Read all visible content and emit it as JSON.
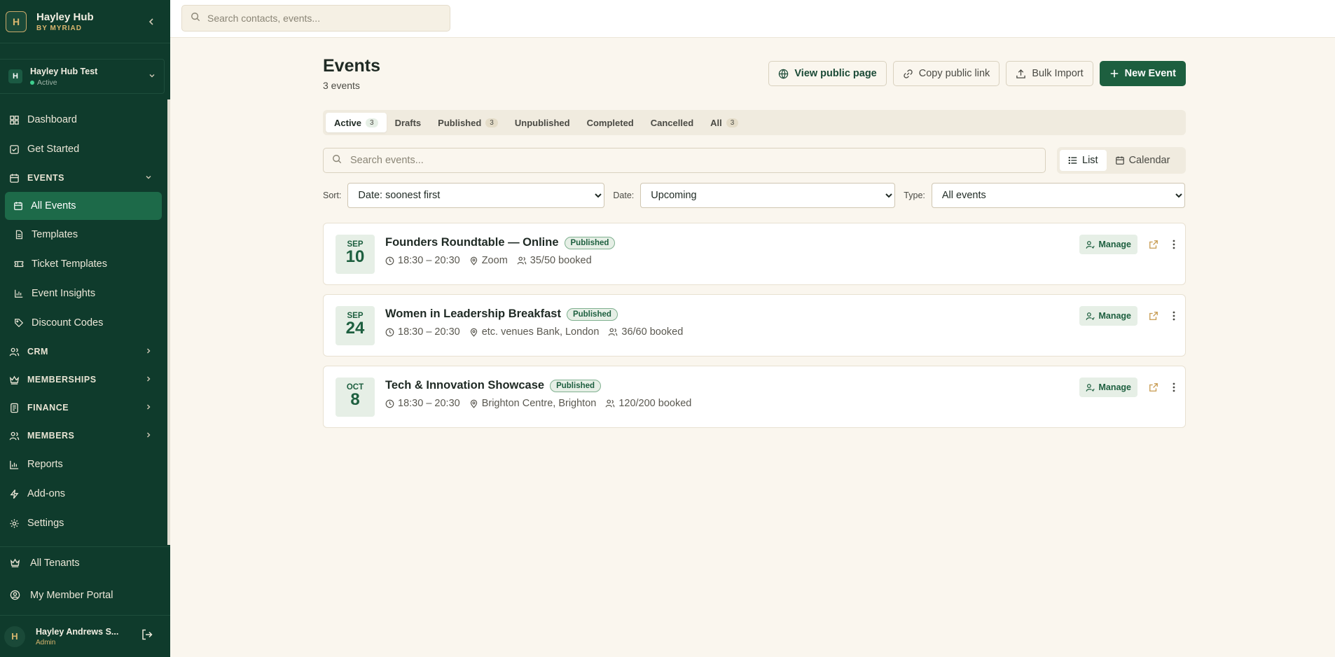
{
  "brand": {
    "logo": "H",
    "name": "Hayley Hub",
    "sub": "BY MYRIAD"
  },
  "tenant": {
    "initial": "H",
    "name": "Hayley Hub Test",
    "status": "Active"
  },
  "nav": {
    "dashboard": "Dashboard",
    "get_started": "Get Started",
    "events_section": "EVENTS",
    "events_items": [
      "All Events",
      "Templates",
      "Ticket Templates",
      "Event Insights",
      "Discount Codes"
    ],
    "crm": "CRM",
    "memberships": "MEMBERSHIPS",
    "finance": "FINANCE",
    "members": "MEMBERS",
    "reports": "Reports",
    "addons": "Add-ons",
    "settings": "Settings"
  },
  "bottom": {
    "all_tenants": "All Tenants",
    "member_portal": "My Member Portal"
  },
  "user": {
    "initial": "H",
    "name": "Hayley Andrews S...",
    "role": "Admin"
  },
  "topbar": {
    "search_placeholder": "Search contacts, events..."
  },
  "page": {
    "title": "Events",
    "subtitle": "3 events",
    "actions": {
      "view_public": "View public page",
      "copy_link": "Copy public link",
      "bulk_import": "Bulk Import",
      "new_event": "New Event"
    }
  },
  "tabs": [
    {
      "label": "Active",
      "count": "3"
    },
    {
      "label": "Drafts",
      "count": ""
    },
    {
      "label": "Published",
      "count": "3"
    },
    {
      "label": "Unpublished",
      "count": ""
    },
    {
      "label": "Completed",
      "count": ""
    },
    {
      "label": "Cancelled",
      "count": ""
    },
    {
      "label": "All",
      "count": "3"
    }
  ],
  "event_search_placeholder": "Search events...",
  "view_toggle": {
    "list": "List",
    "calendar": "Calendar"
  },
  "filters": {
    "sort_label": "Sort:",
    "sort_value": "Date: soonest first",
    "date_label": "Date:",
    "date_value": "Upcoming",
    "type_label": "Type:",
    "type_value": "All events"
  },
  "events": [
    {
      "month": "SEP",
      "day": "10",
      "title": "Founders Roundtable — Online",
      "status": "Published",
      "time": "18:30 – 20:30",
      "location": "Zoom",
      "booked": "35/50 booked",
      "manage": "Manage"
    },
    {
      "month": "SEP",
      "day": "24",
      "title": "Women in Leadership Breakfast",
      "status": "Published",
      "time": "18:30 – 20:30",
      "location": "etc. venues Bank, London",
      "booked": "36/60 booked",
      "manage": "Manage"
    },
    {
      "month": "OCT",
      "day": "8",
      "title": "Tech & Innovation Showcase",
      "status": "Published",
      "time": "18:30 – 20:30",
      "location": "Brighton Centre, Brighton",
      "booked": "120/200 booked",
      "manage": "Manage"
    }
  ],
  "colors": {
    "sidebar": "#0f3b2c",
    "accent": "#1d5f3f",
    "gold": "#d9b66e",
    "background": "#faf6ee"
  }
}
